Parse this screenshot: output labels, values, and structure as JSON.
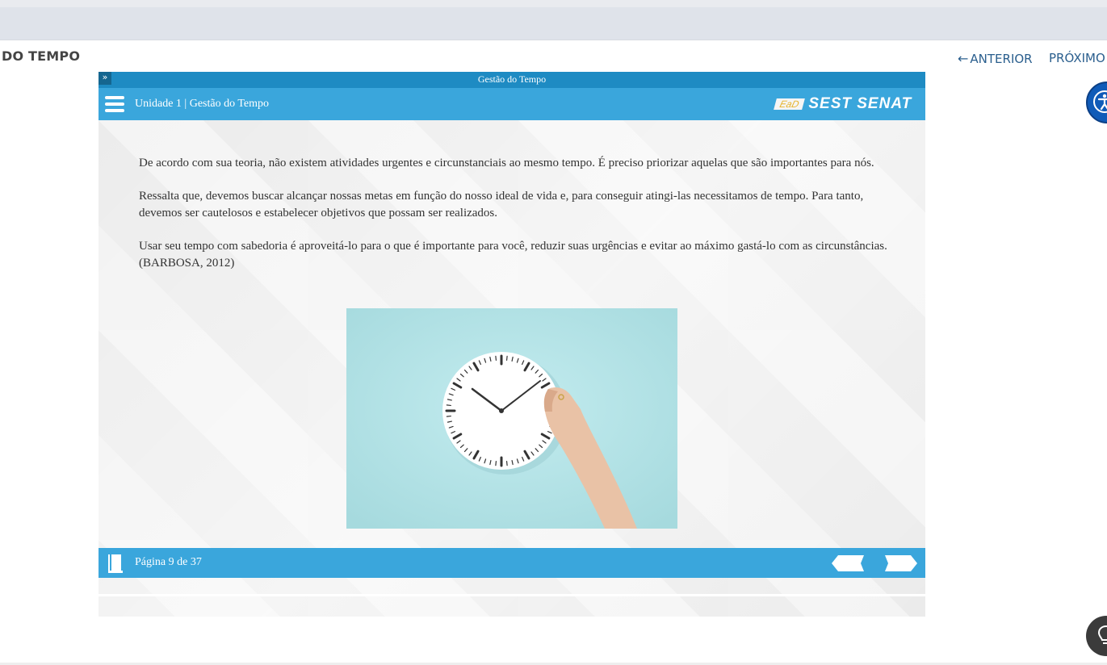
{
  "header": {
    "course_title": "DO TEMPO",
    "prev_label": "ANTERIOR",
    "prev_arrow": "←",
    "next_label": "PRÓXIMO"
  },
  "player": {
    "window_title": "Gestão do Tempo",
    "expand_glyph": "»",
    "unit_title": "Unidade 1 | Gestão do Tempo",
    "brand": {
      "ead": "EaD",
      "name": "SEST SENAT"
    },
    "paragraphs": [
      "De acordo com sua teoria, não existem atividades urgentes e circunstanciais ao mesmo tempo. É preciso priorizar aquelas que são importantes para nós.",
      "Ressalta que, devemos buscar alcançar nossas metas em função do nosso ideal de vida e, para conseguir atingi-las necessitamos de tempo. Para tanto, devemos ser cautelosos e estabelecer objetivos que possam ser realizados.",
      "Usar seu tempo com sabedoria é aproveitá-lo para o que é importante para você, reduzir suas urgências e evitar ao máximo gastá-lo com as circunstâncias. (BARBOSA, 2012)"
    ],
    "page_indicator": "Página 9 de 37"
  },
  "colors": {
    "player_bar": "#3aa6dc",
    "title_bar": "#1e8bc3",
    "nav_link": "#2b5f8e",
    "image_bg": "#b8e4e8"
  }
}
